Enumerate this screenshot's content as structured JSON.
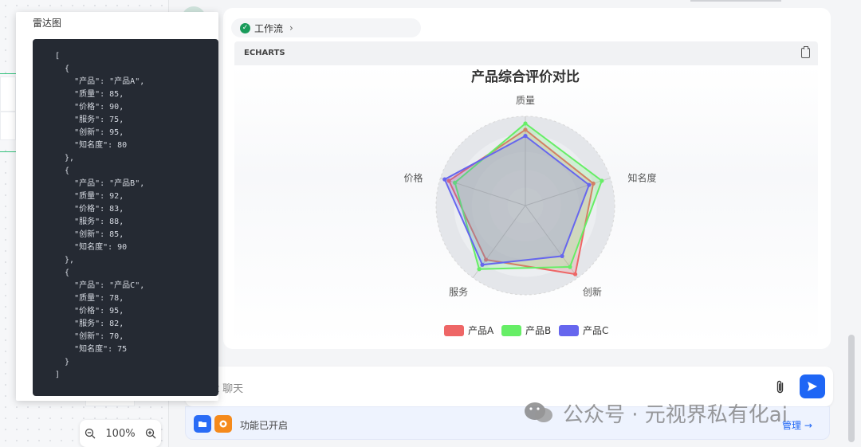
{
  "popup": {
    "title": "雷达图",
    "code": "[\n  {\n    \"产品\": \"产品A\",\n    \"质量\": 85,\n    \"价格\": 90,\n    \"服务\": 75,\n    \"创新\": 95,\n    \"知名度\": 80\n  },\n  {\n    \"产品\": \"产品B\",\n    \"质量\": 92,\n    \"价格\": 83,\n    \"服务\": 88,\n    \"创新\": 85,\n    \"知名度\": 90\n  },\n  {\n    \"产品\": \"产品C\",\n    \"质量\": 78,\n    \"价格\": 95,\n    \"服务\": 82,\n    \"创新\": 70,\n    \"知名度\": 75\n  }\n]"
  },
  "canvas": {
    "zoom_label": "100%"
  },
  "message": {
    "workflow_label": "工作流",
    "code_lang": "ECHARTS"
  },
  "chart_data": {
    "type": "radar",
    "title": "产品综合评价对比",
    "indicators": [
      "质量",
      "知名度",
      "创新",
      "服务",
      "价格"
    ],
    "max": 100,
    "series": [
      {
        "name": "产品A",
        "values": [
          85,
          80,
          95,
          75,
          90
        ],
        "color": "#ee6666"
      },
      {
        "name": "产品B",
        "values": [
          92,
          90,
          85,
          88,
          83
        ],
        "color": "#66ee66"
      },
      {
        "name": "产品C",
        "values": [
          78,
          75,
          70,
          82,
          95
        ],
        "color": "#6666ee"
      }
    ],
    "legend_position": "bottom"
  },
  "input": {
    "placeholder": "ot 聊天"
  },
  "feature_bar": {
    "status_text": "功能已开启",
    "manage_label": "管理 →"
  },
  "watermark": {
    "text": "公众号 · 元视界私有化ai"
  }
}
